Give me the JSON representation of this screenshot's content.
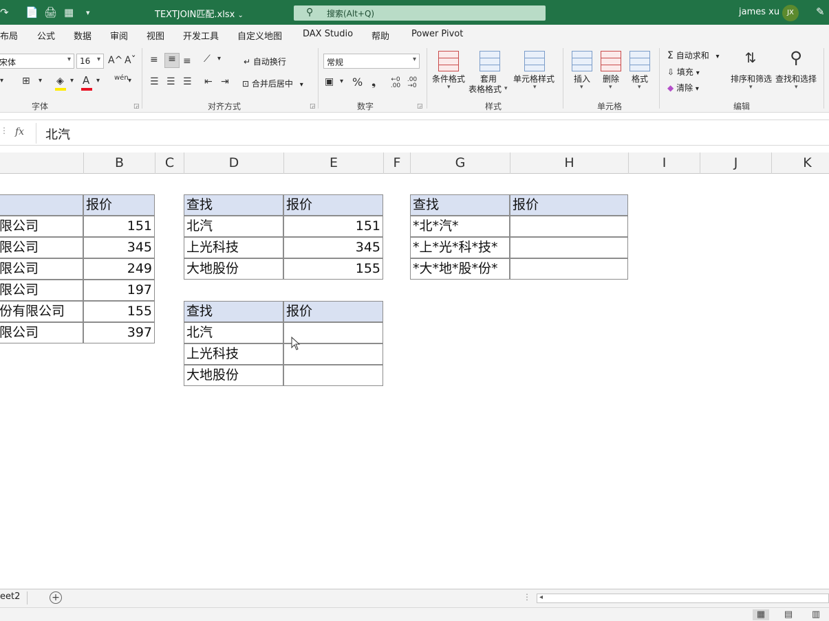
{
  "titlebar": {
    "quick_access": [
      "↷",
      "📄",
      "🖨",
      "▦",
      "▾"
    ],
    "filename": "TEXTJOIN匹配.xlsx",
    "filename_caret": "⌄",
    "search_icon": "⚲",
    "search_placeholder": "搜索(Alt+Q)",
    "user_name": "james xu",
    "user_initials": "JX",
    "pen_icon": "✎"
  },
  "menu": {
    "tabs": [
      "页面布局",
      "公式",
      "数据",
      "审阅",
      "视图",
      "开发工具",
      "自定义地图",
      "DAX Studio",
      "帮助",
      "Power Pivot"
    ]
  },
  "ribbon": {
    "font": {
      "font_name": "宋体",
      "font_size": "16",
      "grow": "A^",
      "shrink": "Aˇ",
      "group_label": "字体"
    },
    "alignment": {
      "wrap_label": "自动换行",
      "merge_label": "合并后居中",
      "group_label": "对齐方式"
    },
    "number": {
      "format": "常规",
      "percent": "%",
      "comma": "❟",
      "inc_dec": "←0 .00",
      "dec_dec": ".00 →0",
      "group_label": "数字"
    },
    "styles": {
      "conditional": "条件格式",
      "table_line1": "套用",
      "table_line2": "表格格式",
      "cell_styles": "单元格样式",
      "group_label": "样式"
    },
    "cells": {
      "insert": "插入",
      "delete": "删除",
      "format": "格式",
      "group_label": "单元格"
    },
    "editing": {
      "autosum": "自动求和",
      "fill": "填充",
      "clear": "清除",
      "sort_filter": "排序和筛选",
      "find_select": "查找和选择",
      "group_label": "编辑"
    }
  },
  "formula_bar": {
    "fx": "fx",
    "value": "北汽"
  },
  "columns": [
    "B",
    "C",
    "D",
    "E",
    "F",
    "G",
    "H",
    "I",
    "J",
    "K"
  ],
  "table_ab": {
    "header": "报价",
    "rows": [
      {
        "name": "限公司",
        "price": "151"
      },
      {
        "name": "限公司",
        "price": "345"
      },
      {
        "name": "限公司",
        "price": "249"
      },
      {
        "name": "限公司",
        "price": "197"
      },
      {
        "name": "份有限公司",
        "price": "155"
      },
      {
        "name": "限公司",
        "price": "397"
      }
    ]
  },
  "table_de_top": {
    "headers": [
      "查找",
      "报价"
    ],
    "rows": [
      {
        "find": "北汽",
        "price": "151"
      },
      {
        "find": "上光科技",
        "price": "345"
      },
      {
        "find": "大地股份",
        "price": "155"
      }
    ]
  },
  "table_de_bottom": {
    "headers": [
      "查找",
      "报价"
    ],
    "rows": [
      {
        "find": "北汽",
        "price": ""
      },
      {
        "find": "上光科技",
        "price": ""
      },
      {
        "find": "大地股份",
        "price": ""
      }
    ]
  },
  "table_gh": {
    "headers": [
      "查找",
      "报价"
    ],
    "rows": [
      {
        "find": "*北*汽*",
        "price": ""
      },
      {
        "find": "*上*光*科*技*",
        "price": ""
      },
      {
        "find": "*大*地*股*份*",
        "price": ""
      }
    ]
  },
  "sheetbar": {
    "active_sheet": "eet2",
    "add_icon": "+"
  },
  "statusbar": {
    "views": [
      "▦",
      "▤",
      "▥"
    ]
  }
}
